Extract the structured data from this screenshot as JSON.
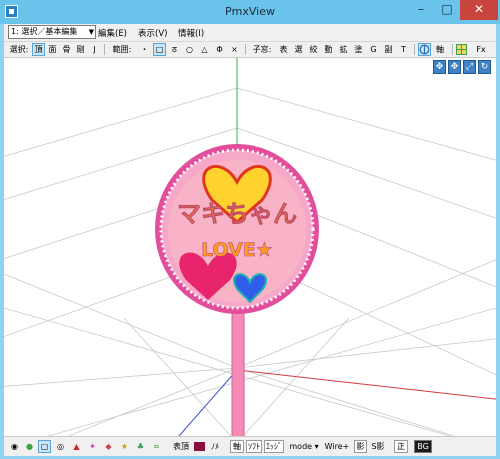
{
  "window": {
    "title": "PmxView",
    "min": "–",
    "max": "□",
    "close": "✕"
  },
  "menubar": {
    "mode_select": "1: 選択／基本編集",
    "items": [
      "編集(E)",
      "表示(V)",
      "情報(I)"
    ]
  },
  "toolbar": {
    "select_label": "選択:",
    "select_items": [
      "頂",
      "面",
      "骨",
      "剛",
      "J"
    ],
    "range_label": "範囲:",
    "range_items": [
      "・",
      "□",
      "ठ",
      "○",
      "△",
      "Φ",
      "×"
    ],
    "subwindow_label": "子窓:",
    "subwindow_items": [
      "表",
      "選",
      "絞",
      "動",
      "拡",
      "塗",
      "G",
      "副",
      "T"
    ],
    "axis_label": "軸",
    "fx_label": "Fx"
  },
  "nav_buttons": [
    "move-xy",
    "move-xz",
    "zoom",
    "rotate"
  ],
  "uchiwa": {
    "line1": "マキちゃん",
    "line2": "LOVE★"
  },
  "statusbar": {
    "items": [
      "表頂",
      "ﾉﾒ",
      "軸",
      "ｿﾌﾄ",
      "ｴｯｼﾞ",
      "mode ▾",
      "Wire+",
      "影",
      "S影",
      "正",
      "BG"
    ]
  },
  "colors": {
    "accent": "#3f83c4",
    "window_frame": "#8fd3f0",
    "close": "#c7453c",
    "uchiwa_border": "#e0539d",
    "uchiwa_face": "#f6a3bd",
    "text_orange": "#ff9b1e"
  }
}
